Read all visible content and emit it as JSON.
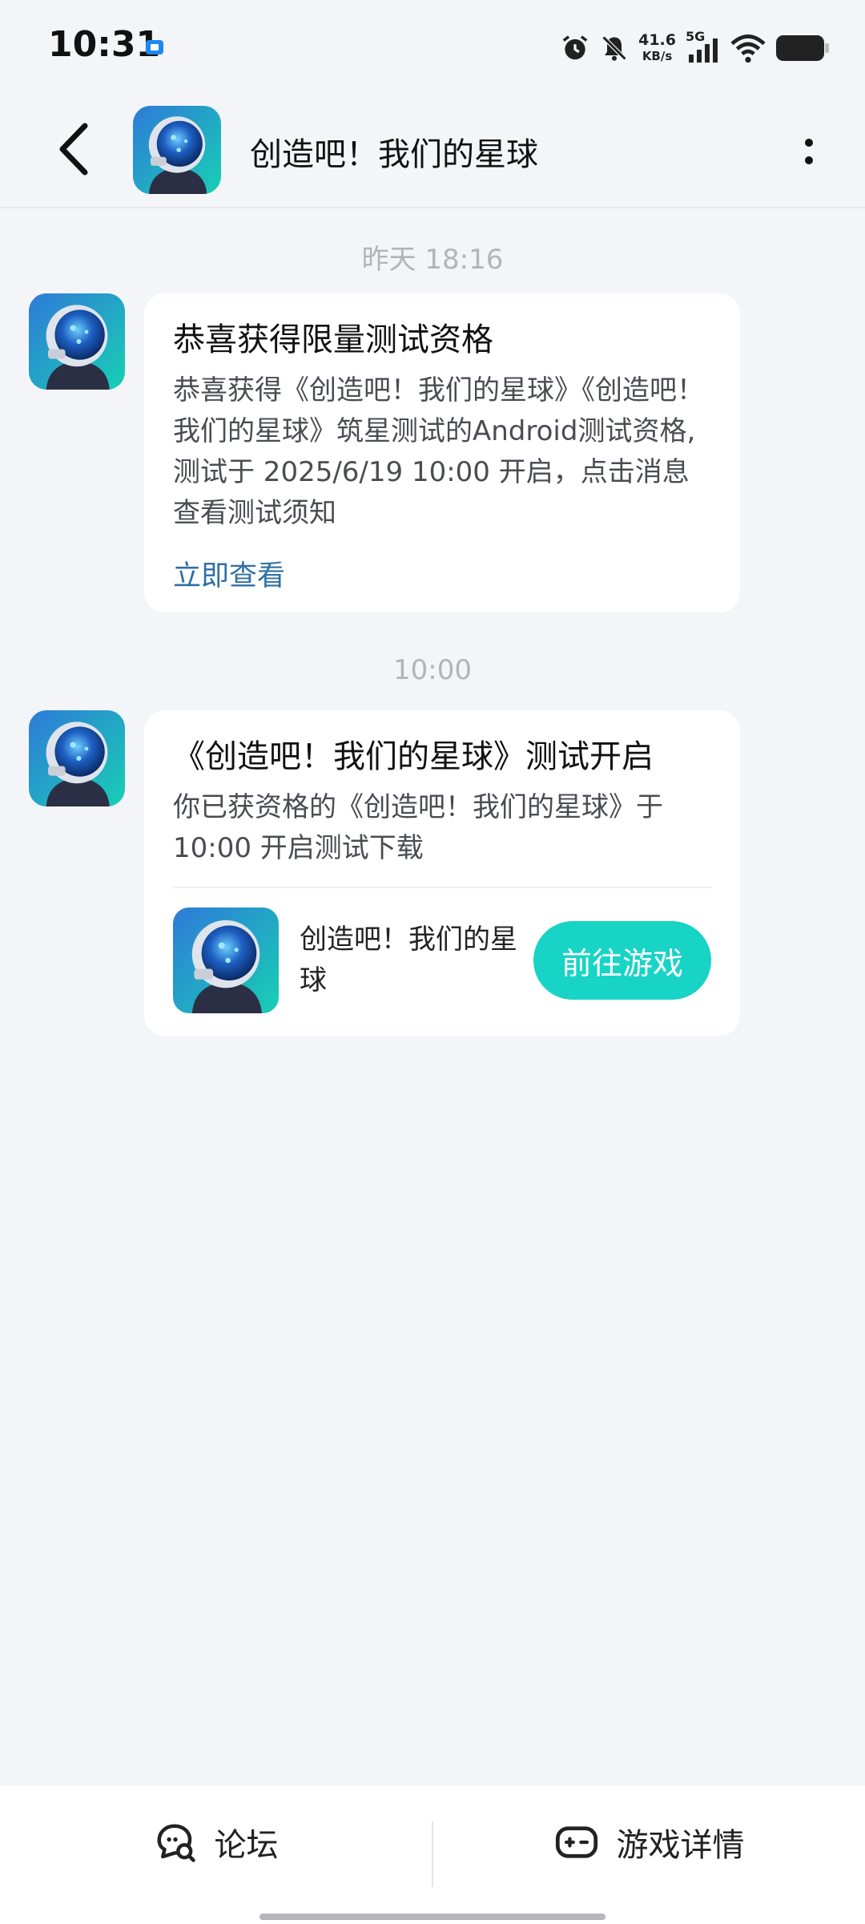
{
  "status_bar": {
    "time": "10:31",
    "net_speed_value": "41.6",
    "net_speed_unit": "KB/s",
    "network_type": "5G",
    "icons": [
      "app-notification-icon",
      "alarm-icon",
      "mute-icon",
      "signal-icon",
      "wifi-icon",
      "battery-icon"
    ]
  },
  "header": {
    "title": "创造吧！我们的星球",
    "back_icon": "back-arrow-icon",
    "more_icon": "more-vertical-icon"
  },
  "messages": [
    {
      "timestamp": "昨天  18:16",
      "title": "恭喜获得限量测试资格",
      "body": "恭喜获得《创造吧！我们的星球》《创造吧！我们的星球》筑星测试的Android测试资格,测试于 2025/6/19 10:00 开启，点击消息查看测试须知",
      "link": "立即查看"
    },
    {
      "timestamp": "10:00",
      "title": "《创造吧！我们的星球》测试开启",
      "body": "你已获资格的《创造吧！我们的星球》于 10:00 开启测试下载",
      "game_name": "创造吧！我们的星球",
      "button": "前往游戏"
    }
  ],
  "bottom_bar": {
    "forum_label": "论坛",
    "details_label": "游戏详情"
  },
  "colors": {
    "accent": "#17d4c6",
    "link": "#2f6fa4",
    "background": "#f4f5f8"
  }
}
